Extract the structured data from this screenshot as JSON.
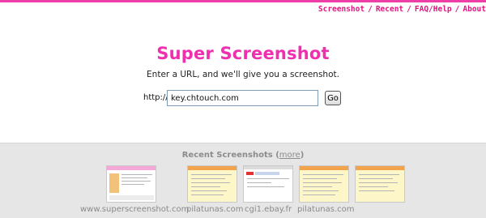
{
  "top_nav": {
    "items": [
      "Screenshot",
      "Recent",
      "FAQ/Help",
      "About"
    ],
    "separator": "/"
  },
  "header": {
    "logo_text": "Super Screenshot",
    "tagline": "Enter a URL, and we'll give you a screenshot."
  },
  "url_form": {
    "prefix": "http://",
    "value": "key.chtouch.com",
    "go_label": "Go"
  },
  "recent": {
    "title": "Recent Screenshots",
    "more_label": "more",
    "captions": [
      "www.superscreenshot.com",
      "pilatunas.com",
      "cgi1.ebay.fr",
      "pilatunas.com"
    ]
  },
  "colors": {
    "brand_pink": "#ef2fae",
    "nav_pink": "#e0147f",
    "panel_gray": "#e6e6e6"
  }
}
